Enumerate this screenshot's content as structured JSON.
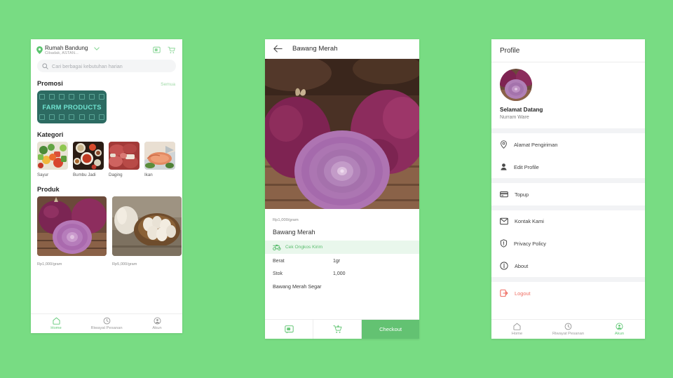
{
  "theme": {
    "background": "#78dc83",
    "accent": "#63c272",
    "accent_light": "#9fd9a6",
    "danger": "#ef6e63",
    "banner_bg": "#2d6b62",
    "banner_text_color": "#6fe3d0"
  },
  "home": {
    "location": {
      "name": "Rumah Bandung",
      "detail": "Cibadak, ASTAN...",
      "pin_icon": "location-pin-icon",
      "chevron_icon": "chevron-down-icon"
    },
    "header_actions": [
      {
        "name": "chat-icon",
        "label": "Chat"
      },
      {
        "name": "cart-icon",
        "label": "Cart"
      }
    ],
    "search": {
      "placeholder": "Cari berbagai kebutuhan harian",
      "value": "",
      "icon": "search-icon"
    },
    "promosi": {
      "title": "Promosi",
      "link": "Semua",
      "banner_text": "FARM PRODUCTS"
    },
    "kategori": {
      "title": "Kategori",
      "items": [
        {
          "label": "Sayur"
        },
        {
          "label": "Bumbu Jadi"
        },
        {
          "label": "Daging"
        },
        {
          "label": "Ikan"
        }
      ]
    },
    "produk": {
      "title": "Produk",
      "items": [
        {
          "price": "Rp1,000",
          "unit": "/gram"
        },
        {
          "price": "Rp5,000",
          "unit": "/gram"
        }
      ]
    },
    "tabbar": [
      {
        "label": "Home",
        "icon": "home-icon",
        "active": true
      },
      {
        "label": "Riwayat Pesanan",
        "icon": "history-clock-icon",
        "active": false
      },
      {
        "label": "Akun",
        "icon": "account-circle-icon",
        "active": false
      }
    ]
  },
  "detail": {
    "back_icon": "back-arrow-icon",
    "title": "Bawang Merah",
    "price": "Rp1,000",
    "price_unit": "/gram",
    "product_name": "Bawang Merah",
    "shipping": {
      "label": "Cek Ongkos Kirim",
      "icon": "delivery-scooter-icon"
    },
    "specs": [
      {
        "key": "Berat",
        "value": "1gr"
      },
      {
        "key": "Stok",
        "value": "1,000"
      }
    ],
    "description": "Bawang Merah Segar",
    "actions": [
      {
        "name": "chat-button",
        "icon": "chat-icon",
        "label": ""
      },
      {
        "name": "add-to-cart-button",
        "icon": "cart-plus-icon",
        "label": ""
      },
      {
        "name": "checkout-button",
        "icon": "",
        "label": "Checkout"
      }
    ]
  },
  "profile": {
    "title": "Profile",
    "welcome": "Selamat Datang",
    "username": "Nurram Ware",
    "avatar_icon": "user-avatar",
    "menu_groups": [
      {
        "items": [
          {
            "label": "Alamat Pengiriman",
            "icon": "location-pin-icon"
          },
          {
            "label": "Edit Profile",
            "icon": "person-icon"
          }
        ]
      },
      {
        "items": [
          {
            "label": "Topup",
            "icon": "credit-card-icon"
          }
        ]
      },
      {
        "items": [
          {
            "label": "Kontak Kami",
            "icon": "mail-icon"
          },
          {
            "label": "Privacy Policy",
            "icon": "shield-icon"
          },
          {
            "label": "About",
            "icon": "info-icon"
          }
        ]
      },
      {
        "items": [
          {
            "label": "Logout",
            "icon": "logout-icon",
            "danger": true
          }
        ]
      }
    ],
    "tabbar": [
      {
        "label": "Home",
        "icon": "home-icon",
        "active": false
      },
      {
        "label": "Riwayat Pesanan",
        "icon": "history-clock-icon",
        "active": false
      },
      {
        "label": "Akun",
        "icon": "account-circle-icon",
        "active": true
      }
    ]
  }
}
